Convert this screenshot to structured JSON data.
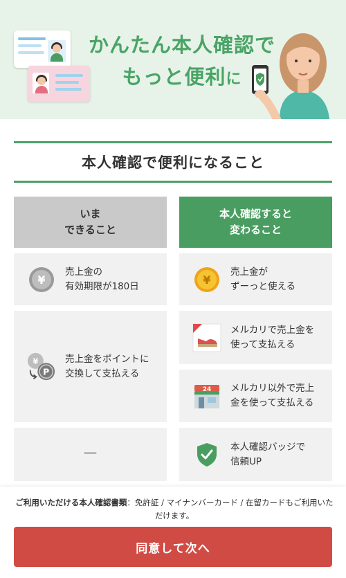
{
  "hero": {
    "title_line1": "かんたん本人確認で",
    "title_line2_main": "もっと便利",
    "title_line2_tail": "に"
  },
  "section": {
    "heading": "本人確認で便利になること"
  },
  "columns": {
    "current_header": "いま\nできること",
    "after_header": "本人確認すると\n変わること"
  },
  "current_items": [
    {
      "text": "売上金の\n有効期限が180日",
      "icon": "yen-coin-gray-icon"
    },
    {
      "text": "売上金をポイントに\n交換して支払える",
      "icon": "yen-to-point-icon"
    },
    {
      "text": "ー",
      "icon": ""
    }
  ],
  "after_items": [
    {
      "text": "売上金が\nずーっと使える",
      "icon": "yen-coin-gold-icon"
    },
    {
      "text": "メルカリで売上金を\n使って支払える",
      "icon": "shoe-product-icon"
    },
    {
      "text": "メルカリ以外で売上\n金を使って支払える",
      "icon": "store-24h-icon"
    },
    {
      "text": "本人確認バッジで\n信頼UP",
      "icon": "verified-shield-icon"
    }
  ],
  "footer": {
    "notice_bold": "ご利用いただける本人確認書類",
    "notice_rest": "：免許証 / マイナンバーカード / 在留カードもご利用いただけます。",
    "agree_button": "同意して次へ"
  },
  "colors": {
    "brand_green": "#4a9d61",
    "hero_bg": "#e7f3e9",
    "button_red": "#d14b45",
    "cell_bg": "#f1f1f1",
    "left_header_bg": "#c9c9c9"
  }
}
